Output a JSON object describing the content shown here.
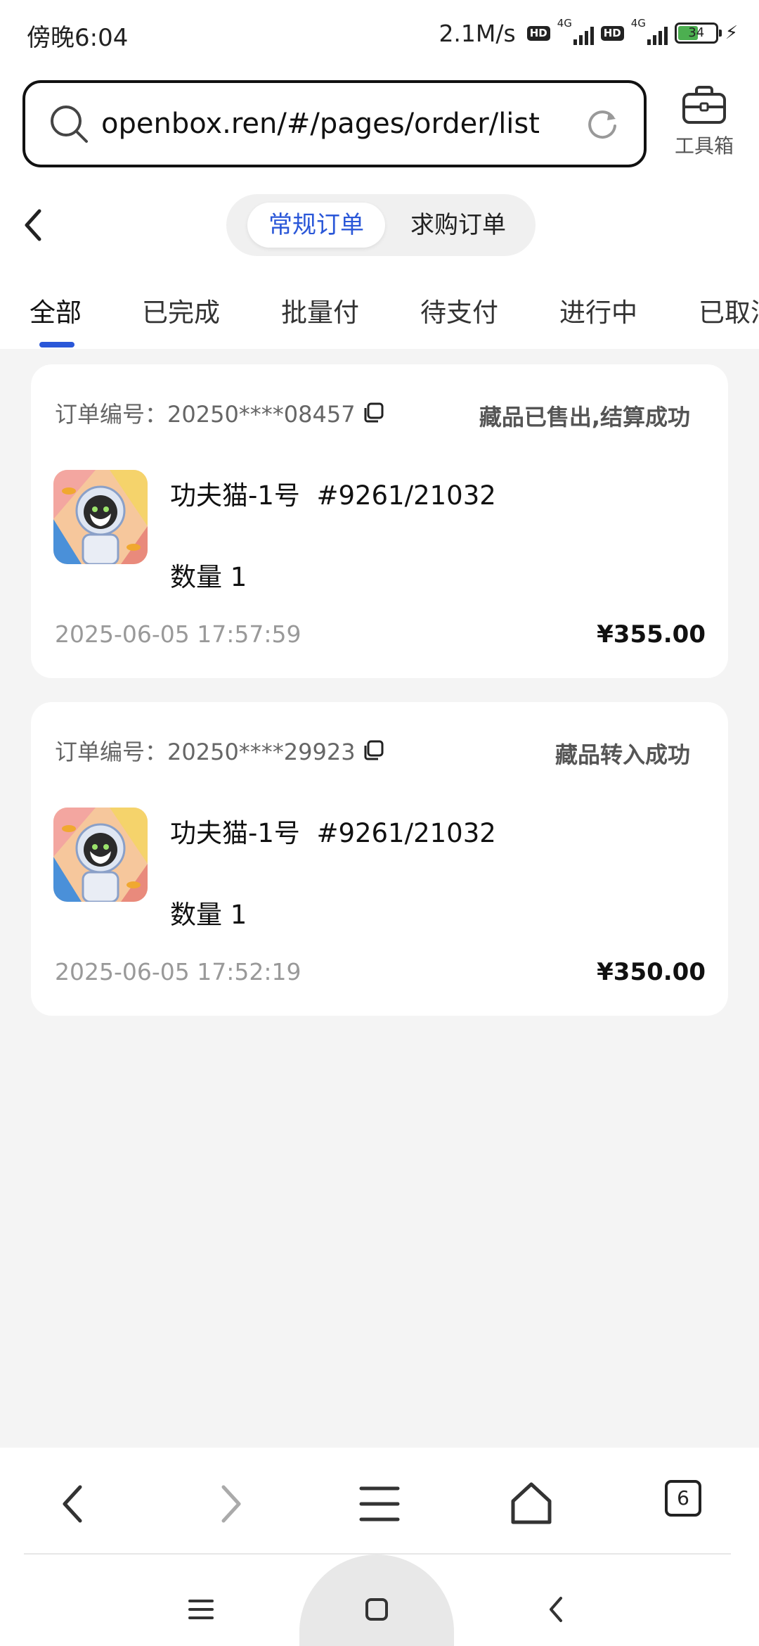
{
  "status_bar": {
    "time": "傍晚6:04",
    "net_speed": "2.1M/s",
    "hd_badge": "HD",
    "network": "4G",
    "battery": "34"
  },
  "address_bar": {
    "url": "openbox.ren/#/pages/order/list",
    "toolbox_label": "工具箱"
  },
  "header": {
    "segments": [
      "常规订单",
      "求购订单"
    ],
    "active_segment": "常规订单"
  },
  "tabs": [
    "全部",
    "已完成",
    "批量付",
    "待支付",
    "进行中",
    "已取消"
  ],
  "active_tab": "全部",
  "orders": [
    {
      "order_no": "订单编号：20250****08457",
      "status": "藏品已售出,结算成功",
      "item_name": "功夫猫-1号",
      "item_serial": "#9261/21032",
      "quantity": "数量 1",
      "time": "2025-06-05 17:57:59",
      "price": "¥355.00"
    },
    {
      "order_no": "订单编号：20250****29923",
      "status": "藏品转入成功",
      "item_name": "功夫猫-1号",
      "item_serial": "#9261/21032",
      "quantity": "数量 1",
      "time": "2025-06-05 17:52:19",
      "price": "¥350.00"
    }
  ],
  "browser_bar": {
    "icons": [
      "back-icon",
      "forward-icon",
      "menu-icon",
      "home-icon",
      "tabs-icon"
    ],
    "tabs_count": "6"
  },
  "system_nav": {
    "icons": [
      "recents-icon",
      "home-square-icon",
      "back-chevron-icon"
    ]
  },
  "colors": {
    "accent": "#2a57d8",
    "page_bg": "#f4f4f4",
    "card_bg": "#ffffff",
    "battery_fill": "#4caf50"
  }
}
